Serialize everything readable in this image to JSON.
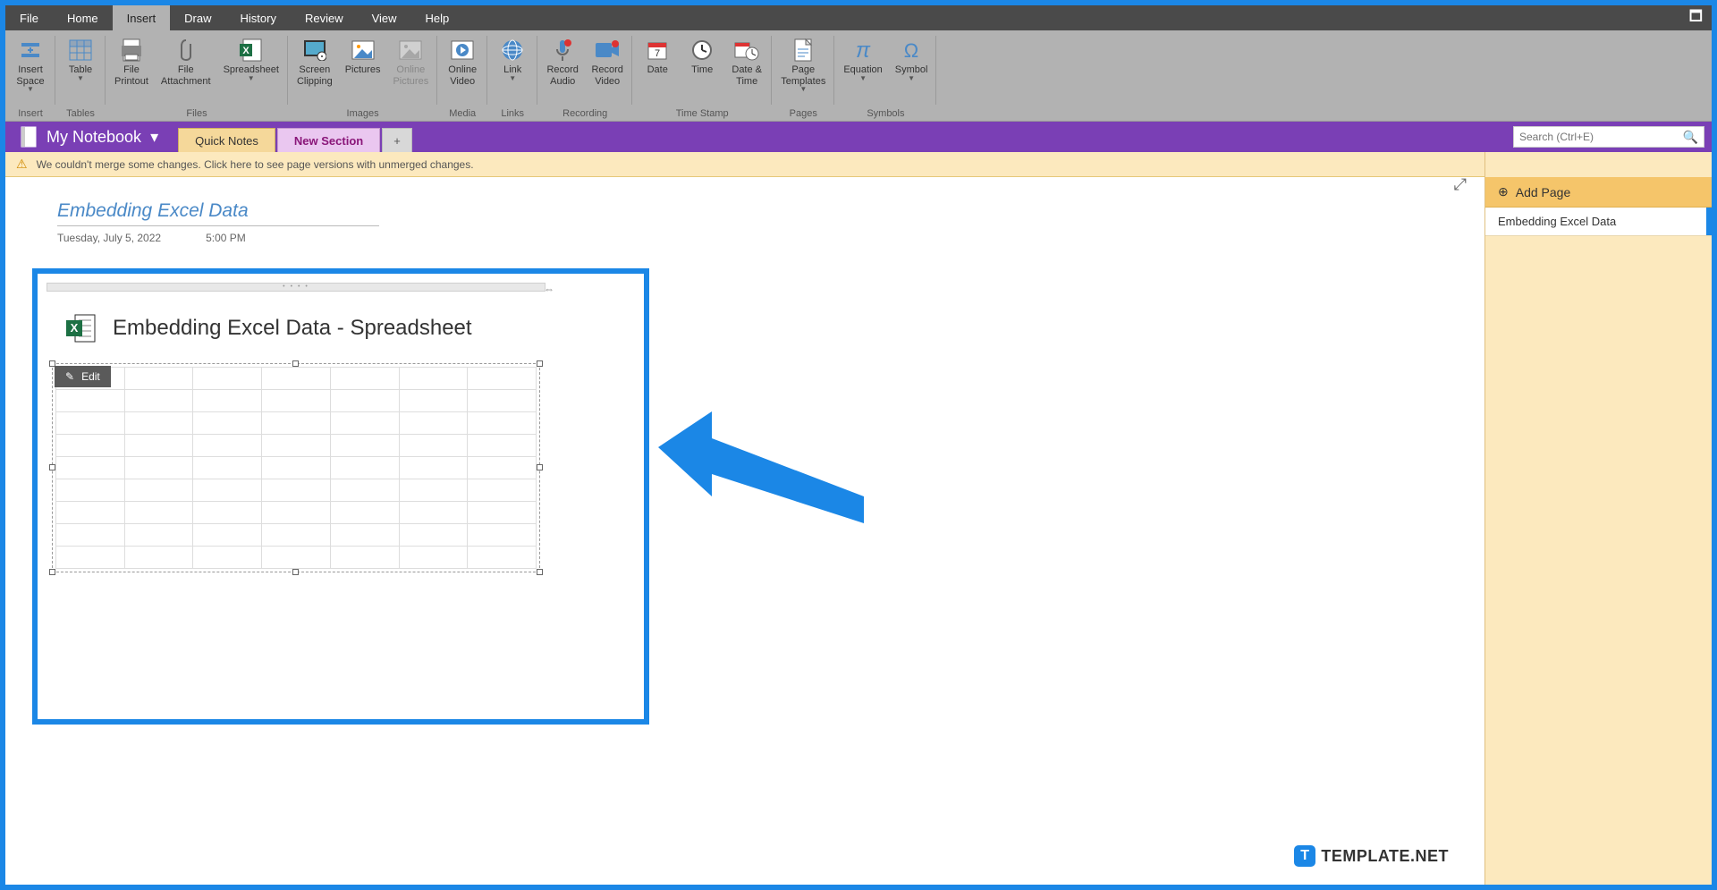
{
  "menubar": [
    "File",
    "Home",
    "Insert",
    "Draw",
    "History",
    "Review",
    "View",
    "Help"
  ],
  "menubar_active": "Insert",
  "ribbon": {
    "groups": [
      {
        "label": "Insert",
        "items": [
          {
            "label": "Insert\nSpace",
            "drop": true
          }
        ]
      },
      {
        "label": "Tables",
        "items": [
          {
            "label": "Table",
            "drop": true
          }
        ]
      },
      {
        "label": "Files",
        "items": [
          {
            "label": "File\nPrintout"
          },
          {
            "label": "File\nAttachment"
          },
          {
            "label": "Spreadsheet",
            "drop": true
          }
        ]
      },
      {
        "label": "Images",
        "items": [
          {
            "label": "Screen\nClipping"
          },
          {
            "label": "Pictures"
          },
          {
            "label": "Online\nPictures",
            "disabled": true
          }
        ]
      },
      {
        "label": "Media",
        "items": [
          {
            "label": "Online\nVideo"
          }
        ]
      },
      {
        "label": "Links",
        "items": [
          {
            "label": "Link",
            "drop": true
          }
        ]
      },
      {
        "label": "Recording",
        "items": [
          {
            "label": "Record\nAudio"
          },
          {
            "label": "Record\nVideo"
          }
        ]
      },
      {
        "label": "Time Stamp",
        "items": [
          {
            "label": "Date"
          },
          {
            "label": "Time"
          },
          {
            "label": "Date &\nTime"
          }
        ]
      },
      {
        "label": "Pages",
        "items": [
          {
            "label": "Page\nTemplates",
            "drop": true
          }
        ]
      },
      {
        "label": "Symbols",
        "items": [
          {
            "label": "Equation",
            "drop": true
          },
          {
            "label": "Symbol",
            "drop": true
          }
        ]
      }
    ]
  },
  "notebook": {
    "title": "My Notebook"
  },
  "tabs": {
    "quick": "Quick Notes",
    "new": "New Section",
    "add": "+"
  },
  "search": {
    "placeholder": "Search (Ctrl+E)"
  },
  "merge_msg": "We couldn't merge some changes. Click here to see page versions with unmerged changes.",
  "page": {
    "title": "Embedding Excel Data",
    "date": "Tuesday, July 5, 2022",
    "time": "5:00 PM"
  },
  "embed": {
    "title": "Embedding Excel Data - Spreadsheet",
    "edit": "Edit"
  },
  "right": {
    "add_page": "Add Page",
    "pages": [
      "Embedding Excel Data"
    ]
  },
  "watermark": "TEMPLATE.NET"
}
